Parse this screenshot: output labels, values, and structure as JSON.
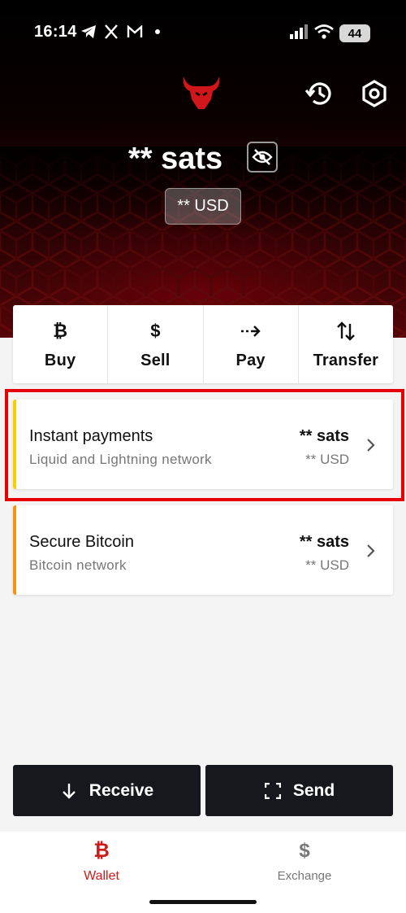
{
  "status_bar": {
    "time": "16:14",
    "battery": "44",
    "icons": [
      "telegram-icon",
      "x-icon",
      "gmail-icon",
      "dot-icon",
      "signal-icon",
      "wifi-icon",
      "battery-icon"
    ]
  },
  "header": {
    "brand_icon": "bull-logo",
    "history_icon": "history-icon",
    "settings_icon": "settings-icon"
  },
  "balance": {
    "amount": "** sats",
    "fiat": "** USD",
    "visibility_icon": "eye-off-icon"
  },
  "actions": [
    {
      "label": "Buy",
      "icon": "₿"
    },
    {
      "label": "Sell",
      "icon": "$"
    },
    {
      "label": "Pay",
      "icon": "pay-arrow-icon"
    },
    {
      "label": "Transfer",
      "icon": "transfer-icon"
    }
  ],
  "accounts": [
    {
      "title": "Instant payments",
      "subtitle": "Liquid and Lightning network",
      "amount": "** sats",
      "fiat": "** USD",
      "accent": "#f5d000"
    },
    {
      "title": "Secure Bitcoin",
      "subtitle": "Bitcoin network",
      "amount": "** sats",
      "fiat": "** USD",
      "accent": "#f29418"
    }
  ],
  "buttons": {
    "receive": "Receive",
    "send": "Send"
  },
  "tabs": [
    {
      "label": "Wallet",
      "icon": "₿",
      "active": true,
      "color": "#cc1a1a"
    },
    {
      "label": "Exchange",
      "icon": "$",
      "active": false,
      "color": "#777777"
    }
  ],
  "colors": {
    "highlight": "#e60000",
    "button_bg": "#16181d"
  }
}
